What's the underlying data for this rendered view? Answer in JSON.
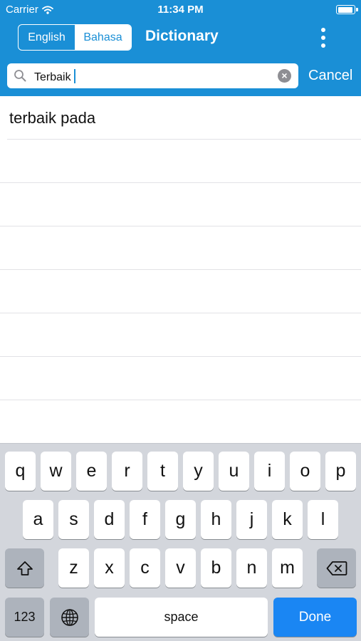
{
  "status_bar": {
    "carrier": "Carrier",
    "time": "11:34 PM",
    "wifi_icon": "wifi-icon",
    "battery_icon": "battery-icon",
    "battery_level": 0.8
  },
  "nav": {
    "segments": [
      {
        "label": "English",
        "selected": false
      },
      {
        "label": "Bahasa",
        "selected": true
      }
    ],
    "title": "Dictionary",
    "more_icon": "more-vertical-icon"
  },
  "search": {
    "value": "Terbaik",
    "search_icon": "search-icon",
    "clear_icon": "clear-icon",
    "cancel_label": "Cancel"
  },
  "results": [
    "terbaik pada"
  ],
  "keyboard": {
    "row1": [
      "q",
      "w",
      "e",
      "r",
      "t",
      "y",
      "u",
      "i",
      "o",
      "p"
    ],
    "row2": [
      "a",
      "s",
      "d",
      "f",
      "g",
      "h",
      "j",
      "k",
      "l"
    ],
    "row3": [
      "z",
      "x",
      "c",
      "v",
      "b",
      "n",
      "m"
    ],
    "shift_icon": "shift-icon",
    "backspace_icon": "backspace-icon",
    "numbers_label": "123",
    "globe_icon": "globe-icon",
    "space_label": "space",
    "done_label": "Done"
  },
  "colors": {
    "header": "#1a8fd6",
    "done_key": "#1a86f3",
    "keyboard_bg": "#d3d6dc"
  }
}
